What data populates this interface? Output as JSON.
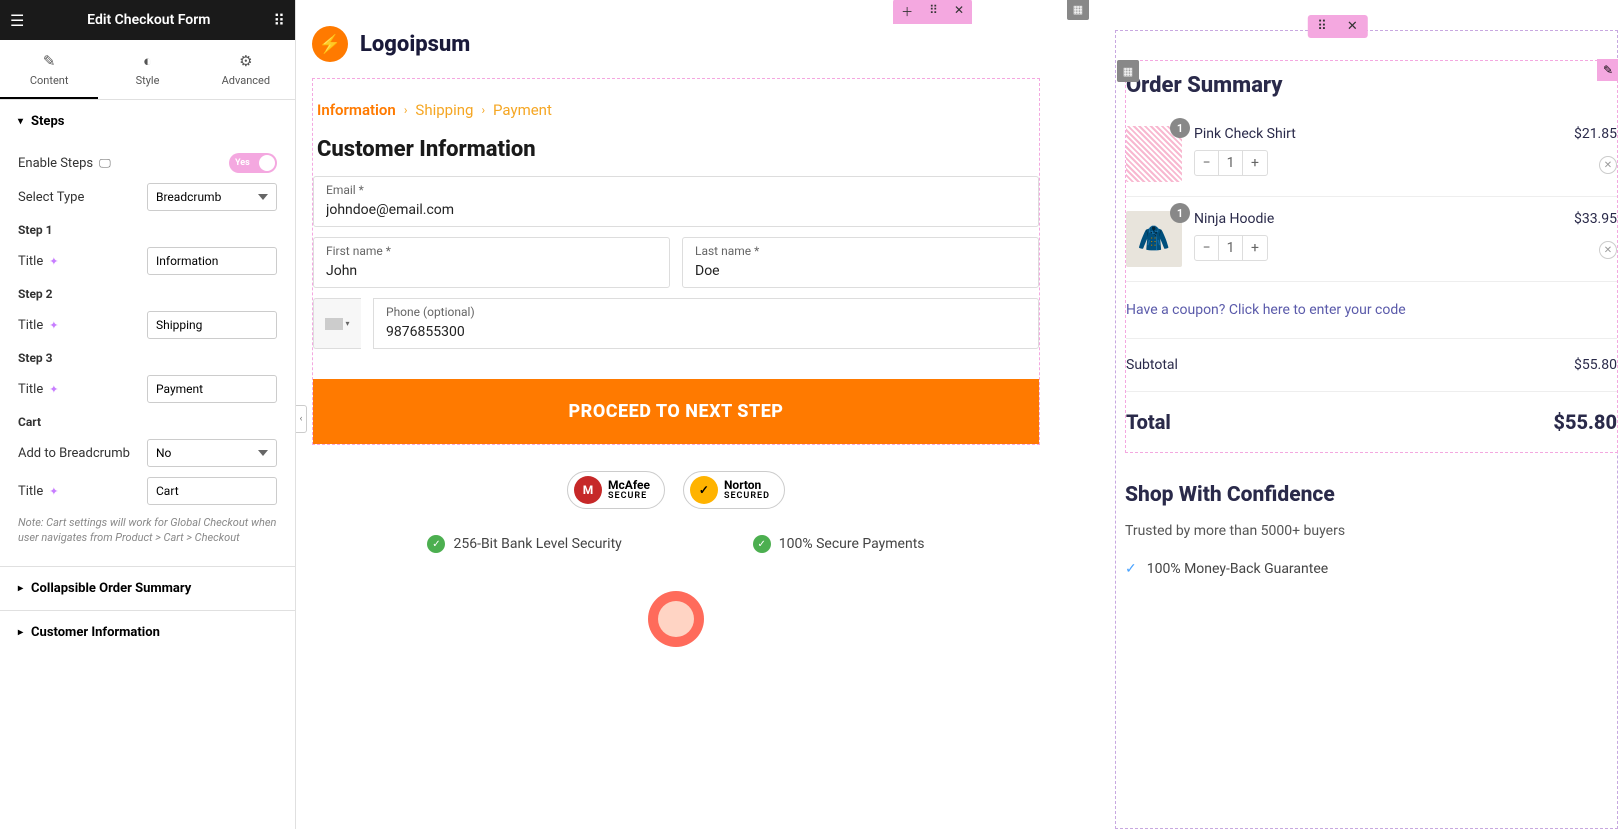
{
  "sidebar": {
    "title": "Edit Checkout Form",
    "tabs": {
      "content": "Content",
      "style": "Style",
      "advanced": "Advanced"
    },
    "steps_section": "Steps",
    "enable_steps": "Enable Steps",
    "toggle_label": "Yes",
    "select_type": "Select Type",
    "select_type_value": "Breadcrumb",
    "step1": "Step 1",
    "step2": "Step 2",
    "step3": "Step 3",
    "title_label": "Title",
    "step1_value": "Information",
    "step2_value": "Shipping",
    "step3_value": "Payment",
    "cart_heading": "Cart",
    "add_breadcrumb": "Add to Breadcrumb",
    "add_breadcrumb_value": "No",
    "cart_title_value": "Cart",
    "note": "Note: Cart settings will work for Global Checkout when user navigates from Product > Cart > Checkout",
    "collapsible": "Collapsible Order Summary",
    "customer_info": "Customer Information"
  },
  "brand": "Logoipsum",
  "breadcrumbs": {
    "info": "Information",
    "ship": "Shipping",
    "pay": "Payment"
  },
  "form": {
    "heading": "Customer Information",
    "email_label": "Email *",
    "email_value": "johndoe@email.com",
    "first_label": "First name *",
    "first_value": "John",
    "last_label": "Last name *",
    "last_value": "Doe",
    "phone_label": "Phone (optional)",
    "phone_value": "9876855300",
    "proceed": "PROCEED TO NEXT STEP"
  },
  "badges": {
    "mcafee_line1": "McAfee",
    "mcafee_line2": "SECURE",
    "norton_line1": "Norton",
    "norton_line2": "SECURED"
  },
  "trust": {
    "a": "256-Bit Bank Level Security",
    "b": "100% Secure Payments"
  },
  "order": {
    "title": "Order Summary",
    "item1": {
      "name": "Pink Check Shirt",
      "price": "$21.85",
      "qty": "1"
    },
    "item2": {
      "name": "Ninja Hoodie",
      "price": "$33.95",
      "qty": "1"
    },
    "coupon": "Have a coupon? Click here to enter your code",
    "subtotal_label": "Subtotal",
    "subtotal_value": "$55.80",
    "total_label": "Total",
    "total_value": "$55.80"
  },
  "confidence": {
    "title": "Shop With Confidence",
    "sub": "Trusted by more than 5000+ buyers",
    "item1": "100% Money-Back Guarantee"
  }
}
